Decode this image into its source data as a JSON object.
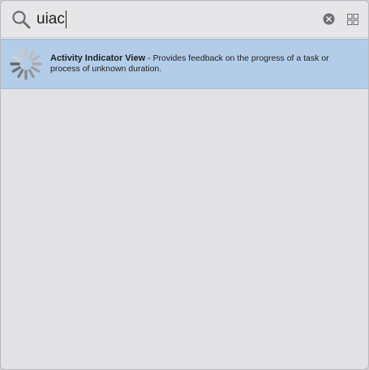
{
  "search": {
    "query": "uiac"
  },
  "icons": {
    "search": "search-icon",
    "clear": "clear-circle-icon",
    "grid": "grid-view-icon",
    "result": "activity-spinner-icon"
  },
  "results": [
    {
      "title": "Activity Indicator View",
      "separator": " - ",
      "description": "Provides feedback on the progress of a task or process of unknown duration."
    }
  ],
  "colors": {
    "selection": "#b3cde9",
    "panel": "#e2e2e4"
  }
}
